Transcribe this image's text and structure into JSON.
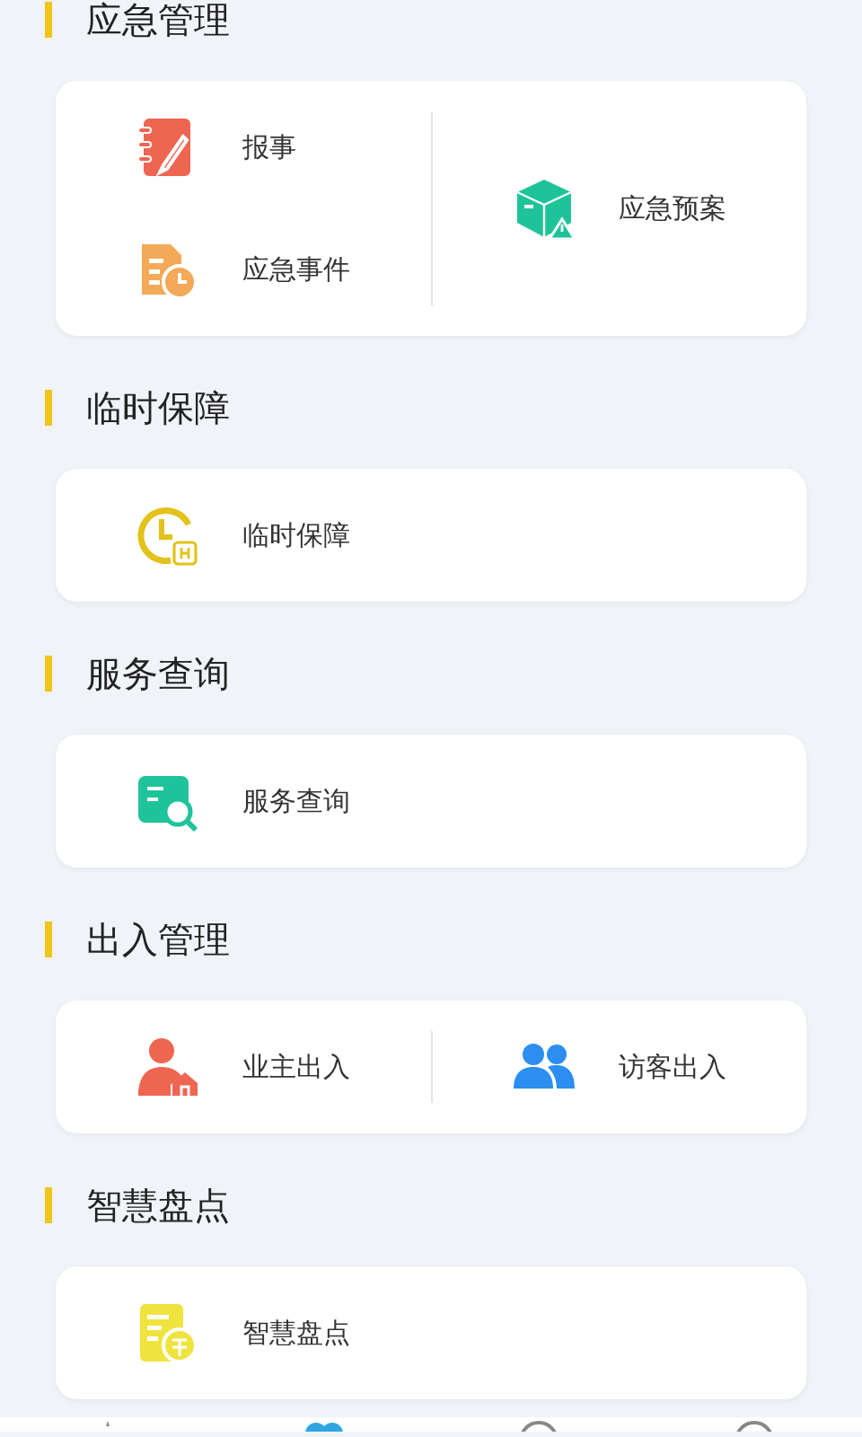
{
  "sections": [
    {
      "title": "应急管理",
      "columns": [
        [
          {
            "label": "报事"
          },
          {
            "label": "应急事件"
          }
        ],
        [
          {
            "label": "应急预案"
          }
        ]
      ]
    },
    {
      "title": "临时保障",
      "columns": [
        [
          {
            "label": "临时保障"
          }
        ]
      ]
    },
    {
      "title": "服务查询",
      "columns": [
        [
          {
            "label": "服务查询"
          }
        ]
      ]
    },
    {
      "title": "出入管理",
      "columns": [
        [
          {
            "label": "业主出入"
          }
        ],
        [
          {
            "label": "访客出入"
          }
        ]
      ]
    },
    {
      "title": "智慧盘点",
      "columns": [
        [
          {
            "label": "智慧盘点"
          }
        ]
      ]
    }
  ],
  "tab_bar": {
    "tabs": [
      {
        "selected": false
      },
      {
        "selected": true
      },
      {
        "selected": false
      },
      {
        "selected": false
      }
    ]
  }
}
